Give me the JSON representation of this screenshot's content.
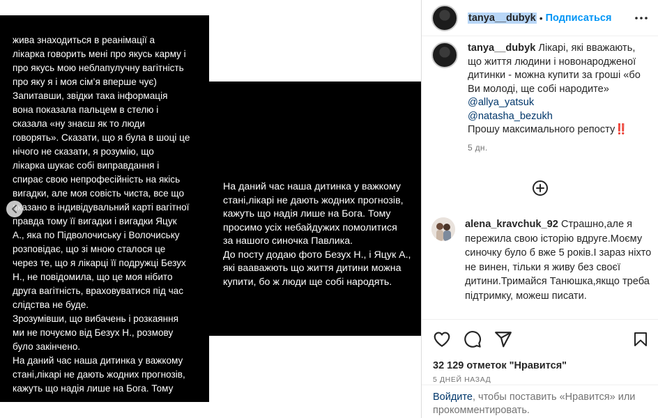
{
  "slides": {
    "left_text": "жива знаходиться в реанімації а\nлікарка говорить мені про якусь карму і\nпро якусь мою неблапулучну вагітність\nпро яку я і моя сім’я вперше чує)\nЗапитавши, звідки така інформація\nвона показала пальцем в стелю і\nсказала «ну знаєш як то люди\nговорять». Сказати, що я була в шоці це\nнічого не сказати, я розумію, що\nлікарка шукає собі виправдання і\nспирає свою непрофесійність на якісь\nвигадки, але моя совість чиста, все що\nвказано в індивідувальний карті вагітної\nправда тому її вигадки і вигадки Яцук\nА., яка по Підволочиську і Волочиську\nрозповідає, що зі мною сталося це\nчерез те, що я лікарці її подружці Безух\nН., не повідомила, що це моя нібито\nдруга вагітність, враховуватися під час\nслідства не буде.\nЗрозумівши, що вибачень і розкаяння\nми не почуємо від Безух Н., розмову\nбуло закінчено.\nНа даний час наша дитинка у важкому\nстані,лікарі не дають жодних прогнозів,\nкажуть що надія лише на Бога. Тому",
    "right_text": "На даний час наша дитинка у важкому\nстані,лікарі не дають жодних прогнозів,\nкажуть що надія лише на Бога. Тому\nпросимо усіх небайдужих помолитися\nза нашого синочка Павлика.\nДо посту додаю фото Безух Н., і Яцук А.,\nякі вааважють що життя дитини можна\nкупити, бо ж люди ще собі народять."
  },
  "header": {
    "username": "tanya__dubyk",
    "separator": "•",
    "follow_label": "Подписаться"
  },
  "caption": {
    "username": "tanya__dubyk",
    "text": "Лікарі, які вважають, що життя людини і новонародженої дитинки - можна купити за гроші «бо Ви молоді, ще собі народите»",
    "mention1": "@allya_yatsuk",
    "mention2": "@natasha_bezukh",
    "closing": "Прошу максимального репосту",
    "emoji": "‼️",
    "time": "5 дн."
  },
  "comment": {
    "username": "alena_kravchuk_92",
    "text": "Страшно,але я пережила свою історію вдруге.Моєму синочку було б вже 5 років.І зараз ніхто не винен, тільки я живу без своєї дитини.Тримайся Танюшка,якщо треба підтримку, можеш писати."
  },
  "stats": {
    "likes": "32 129 отметок \"Нравится\"",
    "posted": "5 ДНЕЙ НАЗАД"
  },
  "login_prompt": {
    "link": "Войдите",
    "text": ", чтобы поставить «Нравится» или прокомментировать."
  },
  "icons": [
    "chevron-left-icon",
    "more-icon",
    "add-comment-icon",
    "heart-icon",
    "comment-icon",
    "share-icon",
    "bookmark-icon"
  ],
  "colors": {
    "link_blue": "#0095f6",
    "mention_blue": "#00376b",
    "muted": "#737373"
  }
}
